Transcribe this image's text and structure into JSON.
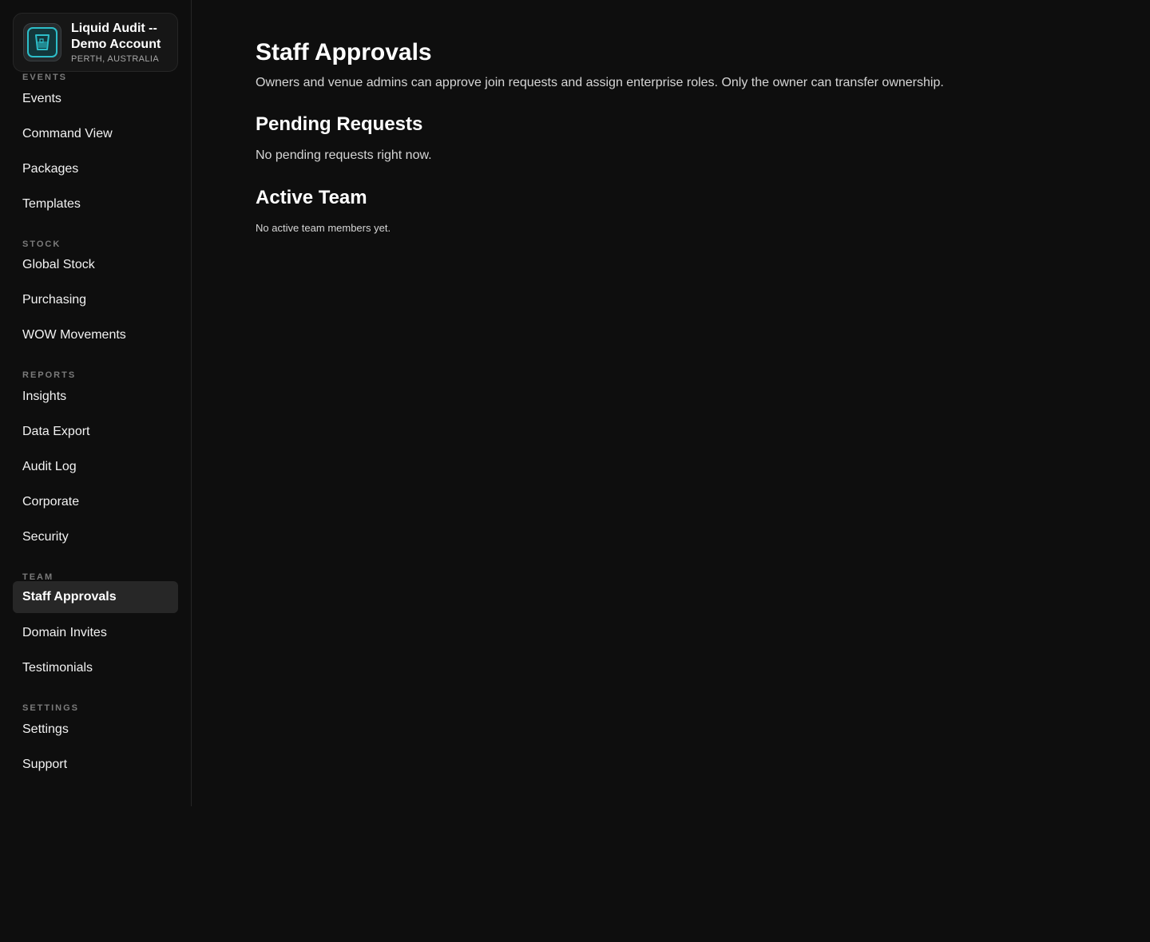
{
  "account": {
    "name": "Liquid Audit -- Demo Account",
    "location": "PERTH, AUSTRALIA",
    "logo_icon": "glass-logo-icon",
    "accent_color": "#2dbec9"
  },
  "sidebar": {
    "groups": [
      {
        "heading": "EVENTS",
        "items": [
          "Events",
          "Command View",
          "Packages",
          "Templates"
        ]
      },
      {
        "heading": "STOCK",
        "items": [
          "Global Stock",
          "Purchasing",
          "WOW Movements"
        ]
      },
      {
        "heading": "REPORTS",
        "items": [
          "Insights",
          "Data Export",
          "Audit Log",
          "Corporate",
          "Security"
        ]
      },
      {
        "heading": "TEAM",
        "items": [
          "Staff Approvals",
          "Domain Invites",
          "Testimonials"
        ]
      },
      {
        "heading": "SETTINGS",
        "items": [
          "Settings",
          "Support"
        ]
      }
    ],
    "active_item": "Staff Approvals"
  },
  "main": {
    "title": "Staff Approvals",
    "description": "Owners and venue admins can approve join requests and assign enterprise roles. Only the owner can transfer ownership.",
    "pending": {
      "title": "Pending Requests",
      "empty_text": "No pending requests right now."
    },
    "team": {
      "title": "Active Team",
      "empty_text": "No active team members yet."
    }
  }
}
